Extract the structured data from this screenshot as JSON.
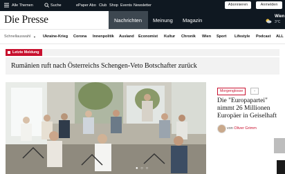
{
  "topbar": {
    "menu_label": "Alle Themen",
    "search_label": "Suche",
    "links": [
      "ePaper",
      "Abo",
      "Club",
      "Shop",
      "Events",
      "Newsletter"
    ],
    "subscribe_label": "Abonnieren",
    "login_label": "Anmelden"
  },
  "brand": {
    "logo": "Die Presse"
  },
  "nav": {
    "items": [
      "Nachrichten",
      "Meinung",
      "Magazin"
    ],
    "active": "Nachrichten",
    "weather_city": "Wien",
    "weather_temp": "3°C"
  },
  "tags": [
    "Schnellauswahl",
    "Ukraine-Krieg",
    "Corona",
    "Innenpolitik",
    "Ausland",
    "Economist",
    "Kultur",
    "Chronik",
    "Wien",
    "Sport",
    "Lifestyle",
    "Podcast",
    "ALL"
  ],
  "breaking": {
    "label": "Letzte Meldung",
    "headline": "Rumänien ruft nach Österreichs Schengen-Veto Botschafter zurück"
  },
  "teaser": {
    "badge": "Morgenglosse",
    "title": "Die \"Europapartei\" nimmt 26 Millionen Europäer in Geiselhaft",
    "author_prefix": "von",
    "author": "Oliver Grimm"
  },
  "colors": {
    "brand_red": "#c8102e",
    "nav_dark": "#0f1821"
  }
}
